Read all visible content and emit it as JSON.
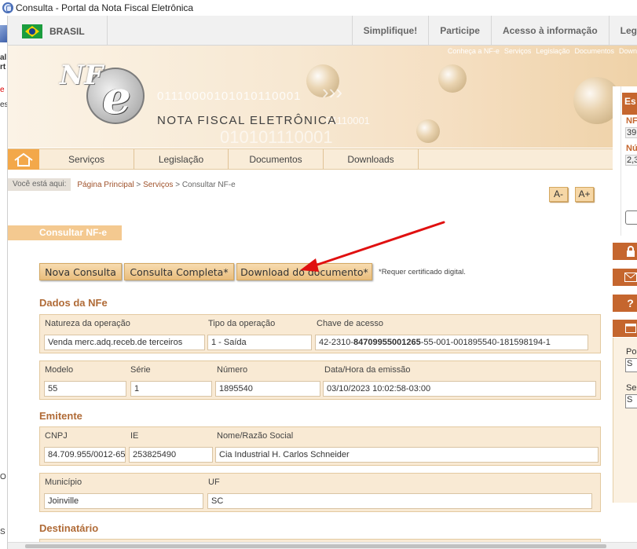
{
  "window": {
    "title": "Consulta - Portal da Nota Fiscal Eletrônica"
  },
  "left_strip": {
    "texts": [
      "al",
      "rt",
      "e",
      "es",
      "O",
      "S"
    ]
  },
  "gov_bar": {
    "country": "BRASIL",
    "links": [
      "Simplifique!",
      "Participe",
      "Acesso à informação",
      "Leg"
    ]
  },
  "banner": {
    "top_links": [
      "Conheça a NF-e",
      "Serviços",
      "Legislação",
      "Documentos",
      "Down"
    ],
    "logo_nf": "NF",
    "logo_e": "e",
    "title": "NOTA FISCAL ELETRÔNICA",
    "binary_1": "01110000101010110001",
    "binary_2": "01110001",
    "binary_3": "010101110001"
  },
  "nav": {
    "items": [
      "Serviços",
      "Legislação",
      "Documentos",
      "Downloads"
    ]
  },
  "breadcrumb": {
    "label": "Você está aqui:",
    "home": "Página Principal",
    "sep": " > ",
    "services": "Serviços",
    "current": "Consultar NF-e"
  },
  "font_buttons": {
    "decrease": "A-",
    "increase": "A+"
  },
  "sidebar": {
    "header": "Es",
    "nfe_label": "NF",
    "nfe_value": "39",
    "num_label": "Nú",
    "num_value": "2,3",
    "portal_label": "Po",
    "portal_value": "S",
    "service_label": "Se",
    "service_value": "S",
    "icons": [
      "lock-icon",
      "envelope-icon",
      "help-icon",
      "window-icon"
    ],
    "help_glyph": "?"
  },
  "content": {
    "title": "Consultar NF-e",
    "buttons": {
      "nova": "Nova Consulta",
      "completa": "Consulta Completa*",
      "download": "Download do documento*"
    },
    "req_note": "*Requer certificado digital.",
    "dados": {
      "heading": "Dados da NFe",
      "natureza_label": "Natureza da operação",
      "natureza": "Venda merc.adq.receb.de terceiros",
      "tipo_label": "Tipo da operação",
      "tipo": "1 - Saída",
      "chave_label": "Chave de acesso",
      "chave_prefix": "42-2310-",
      "chave_bold": "84709955001265",
      "chave_suffix": "-55-001-001895540-181598194-1",
      "modelo_label": "Modelo",
      "modelo": "55",
      "serie_label": "Série",
      "serie": "1",
      "numero_label": "Número",
      "numero": "1895540",
      "emissao_label": "Data/Hora da emissão",
      "emissao": "03/10/2023 10:02:58-03:00"
    },
    "emitente": {
      "heading": "Emitente",
      "cnpj_label": "CNPJ",
      "cnpj": "84.709.955/0012-65",
      "ie_label": "IE",
      "ie": "253825490",
      "nome_label": "Nome/Razão Social",
      "nome": "Cia Industrial H. Carlos Schneider",
      "municipio_label": "Município",
      "municipio": "Joinville",
      "uf_label": "UF",
      "uf": "SC"
    },
    "destinatario": {
      "heading": "Destinatário"
    }
  },
  "colors": {
    "accent_orange": "#f3a84a",
    "title_bar_orange": "#f4c990",
    "section_brown": "#b06b37",
    "sidebar_rust": "#c5662e",
    "annotation_arrow": "#e01010"
  }
}
